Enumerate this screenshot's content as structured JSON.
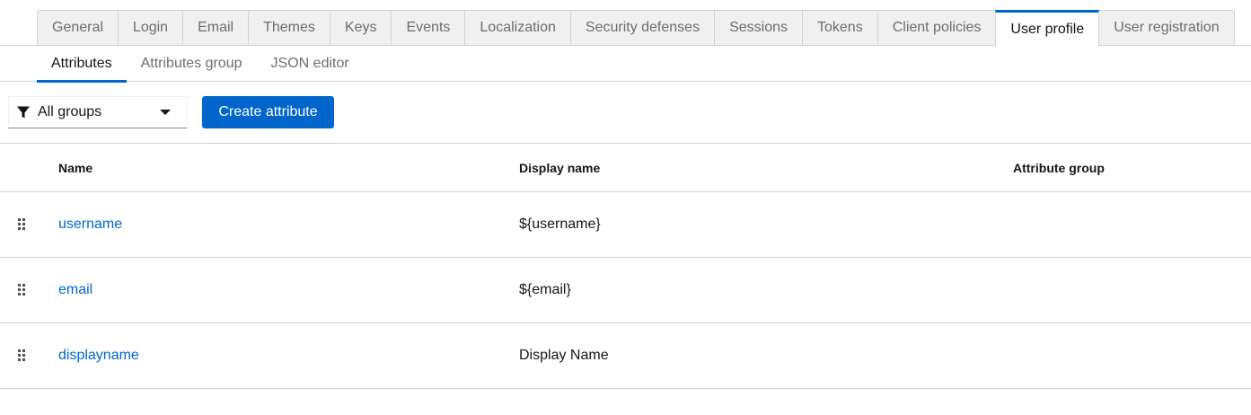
{
  "top_tabs": [
    {
      "label": "General",
      "active": false
    },
    {
      "label": "Login",
      "active": false
    },
    {
      "label": "Email",
      "active": false
    },
    {
      "label": "Themes",
      "active": false
    },
    {
      "label": "Keys",
      "active": false
    },
    {
      "label": "Events",
      "active": false
    },
    {
      "label": "Localization",
      "active": false
    },
    {
      "label": "Security defenses",
      "active": false
    },
    {
      "label": "Sessions",
      "active": false
    },
    {
      "label": "Tokens",
      "active": false
    },
    {
      "label": "Client policies",
      "active": false
    },
    {
      "label": "User profile",
      "active": true
    },
    {
      "label": "User registration",
      "active": false
    }
  ],
  "sub_tabs": [
    {
      "label": "Attributes",
      "active": true
    },
    {
      "label": "Attributes group",
      "active": false
    },
    {
      "label": "JSON editor",
      "active": false
    }
  ],
  "toolbar": {
    "filter_select": {
      "selected": "All groups",
      "icon": "filter-icon"
    },
    "create_button": "Create attribute"
  },
  "table": {
    "columns": [
      "Name",
      "Display name",
      "Attribute group"
    ],
    "rows": [
      {
        "name": "username",
        "display_name": "${username}",
        "group": ""
      },
      {
        "name": "email",
        "display_name": "${email}",
        "group": ""
      },
      {
        "name": "displayname",
        "display_name": "Display Name",
        "group": ""
      }
    ]
  },
  "colors": {
    "accent": "#0066cc",
    "border": "#d2d2d2",
    "inactive_tab_bg": "#f0f0f0",
    "muted_text": "#6a6e73"
  }
}
